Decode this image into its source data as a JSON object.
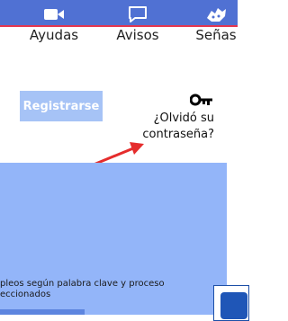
{
  "nav": {
    "items": [
      {
        "label": "Ayudas",
        "icon": "video-camera-icon"
      },
      {
        "label": "Avisos",
        "icon": "message-bubble-icon"
      },
      {
        "label": "Señas",
        "icon": "sign-language-icon"
      }
    ]
  },
  "auth": {
    "register_label": "Registrarse",
    "forgot_password_line1": "¿Olvidó su",
    "forgot_password_line2": "contraseña?",
    "key_icon": "key-icon"
  },
  "panel": {
    "text_line1": "pleos según palabra clave y proceso",
    "text_line2": "eccionados"
  },
  "social": {
    "icon": "facebook-icon"
  },
  "colors": {
    "topbar": "#5071d3",
    "topbar_accent": "#e4364f",
    "register_button": "#a6c3f6",
    "panel": "#93b5f9",
    "arrow": "#e52c2c",
    "facebook": "#1f56b7"
  }
}
